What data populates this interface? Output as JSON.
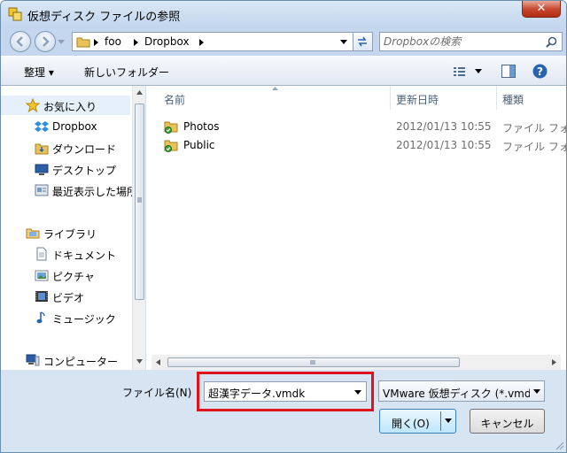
{
  "window": {
    "title": "仮想ディスク ファイルの参照",
    "close_label": "✕"
  },
  "address": {
    "crumbs": [
      "foo",
      "Dropbox"
    ]
  },
  "search": {
    "placeholder": "Dropboxの検索"
  },
  "toolbar": {
    "organize_label": "整理 ▾",
    "new_folder_label": "新しいフォルダー"
  },
  "navpane": {
    "favorites_label": "お気に入り",
    "favorites": [
      "Dropbox",
      "ダウンロード",
      "デスクトップ",
      "最近表示した場所"
    ],
    "libraries_label": "ライブラリ",
    "libraries": [
      "ドキュメント",
      "ピクチャ",
      "ビデオ",
      "ミュージック"
    ],
    "computer_label": "コンピューター"
  },
  "filelist": {
    "columns": [
      "名前",
      "更新日時",
      "種類"
    ],
    "rows": [
      {
        "name": "Photos",
        "modified": "2012/01/13 10:55",
        "type": "ファイル フォ"
      },
      {
        "name": "Public",
        "modified": "2012/01/13 10:55",
        "type": "ファイル フォ"
      }
    ]
  },
  "footer": {
    "filename_label": "ファイル名(N)",
    "filename_value": "超漢字データ.vmdk",
    "filter_value": "VMware 仮想ディスク (*.vmd",
    "open_label": "開く(O)",
    "cancel_label": "キャンセル"
  },
  "colors": {
    "highlight_border": "#e0141c",
    "accent": "#3c7fb1"
  }
}
